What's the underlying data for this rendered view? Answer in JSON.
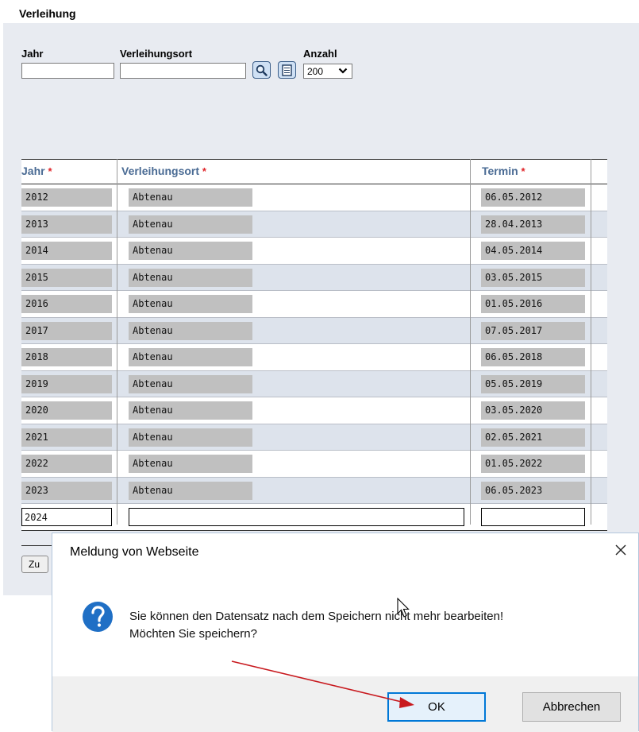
{
  "page": {
    "title": "Verleihung"
  },
  "filters": {
    "jahr_label": "Jahr",
    "jahr_value": "",
    "ort_label": "Verleihungsort",
    "ort_value": "",
    "anzahl_label": "Anzahl",
    "anzahl_value": "200"
  },
  "table": {
    "columns": [
      "Jahr",
      "Verleihungsort",
      "Termin"
    ],
    "required_marker": "*",
    "rows": [
      {
        "jahr": "2012",
        "ort": "Abtenau",
        "termin": "06.05.2012"
      },
      {
        "jahr": "2013",
        "ort": "Abtenau",
        "termin": "28.04.2013"
      },
      {
        "jahr": "2014",
        "ort": "Abtenau",
        "termin": "04.05.2014"
      },
      {
        "jahr": "2015",
        "ort": "Abtenau",
        "termin": "03.05.2015"
      },
      {
        "jahr": "2016",
        "ort": "Abtenau",
        "termin": "01.05.2016"
      },
      {
        "jahr": "2017",
        "ort": "Abtenau",
        "termin": "07.05.2017"
      },
      {
        "jahr": "2018",
        "ort": "Abtenau",
        "termin": "06.05.2018"
      },
      {
        "jahr": "2019",
        "ort": "Abtenau",
        "termin": "05.05.2019"
      },
      {
        "jahr": "2020",
        "ort": "Abtenau",
        "termin": "03.05.2020"
      },
      {
        "jahr": "2021",
        "ort": "Abtenau",
        "termin": "02.05.2021"
      },
      {
        "jahr": "2022",
        "ort": "Abtenau",
        "termin": "01.05.2022"
      },
      {
        "jahr": "2023",
        "ort": "Abtenau",
        "termin": "06.05.2023"
      }
    ],
    "new_row": {
      "jahr": "2024",
      "ort": "",
      "termin": ""
    }
  },
  "footer": {
    "zu_button_label": "Zu"
  },
  "dialog": {
    "title": "Meldung von Webseite",
    "message_line1": "Sie können den Datensatz nach dem Speichern nicht mehr bearbeiten!",
    "message_line2": "Möchten Sie speichern?",
    "ok_label": "OK",
    "cancel_label": "Abbrechen",
    "icon": "question-icon"
  },
  "colors": {
    "panel_bg": "#e8ebf1",
    "header_text": "#4a6b94",
    "required": "#e0262b",
    "ok_border": "#0078d7",
    "question_icon": "#1f6fc5",
    "arrow": "#c8191e"
  }
}
